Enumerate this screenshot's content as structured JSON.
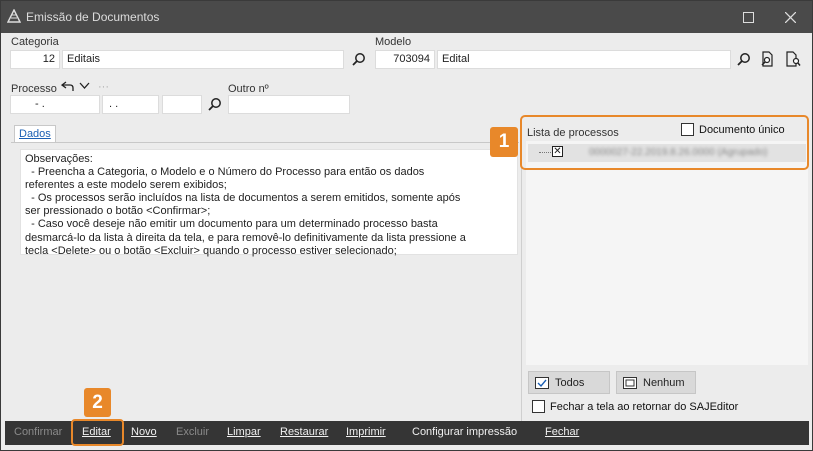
{
  "window": {
    "title": "Emissão de Documentos"
  },
  "form": {
    "categoria": {
      "label": "Categoria",
      "code": "12",
      "name": "Editais"
    },
    "modelo": {
      "label": "Modelo",
      "code": "703094",
      "name": "Edital"
    },
    "processo": {
      "label": "Processo",
      "part1": "- .",
      "part2": ". .",
      "part3": "",
      "dots": "···"
    },
    "outro": {
      "label": "Outro nº",
      "value": ""
    }
  },
  "tabs": [
    {
      "label": "Dados"
    }
  ],
  "observacoes": "Observações:\n  - Preencha a Categoria, o Modelo e o Número do Processo para então os dados\nreferentes a este modelo serem exibidos;\n  - Os processos serão incluídos na lista de documentos a serem emitidos, somente após\nser pressionado o botão <Confirmar>;\n  - Caso você deseje não emitir um documento para um determinado processo basta\ndesmarcá-lo da lista à direita da tela, e para removê-lo definitivamente da lista pressione a\ntecla <Delete> ou o botão <Excluir> quando o processo estiver selecionado;",
  "right_panel": {
    "list_label": "Lista de processos",
    "documento_unico": "Documento único",
    "row_text": "0000027-22.2019.8.26.0000 (Agrupado)",
    "todos": "Todos",
    "nenhum": "Nenhum",
    "fechar_label": "Fechar a tela ao retornar do SAJEditor"
  },
  "badges": {
    "one": "1",
    "two": "2"
  },
  "toolbar": {
    "confirmar": "Confirmar",
    "editar": "Editar",
    "novo": "Novo",
    "excluir": "Excluir",
    "limpar": "Limpar",
    "restaurar": "Restaurar",
    "imprimir": "Imprimir",
    "configurar": "Configurar impressão",
    "fechar": "Fechar"
  },
  "colors": {
    "accent": "#e8882a",
    "titlebar": "#4a4a4a",
    "toolbar": "#353535"
  }
}
